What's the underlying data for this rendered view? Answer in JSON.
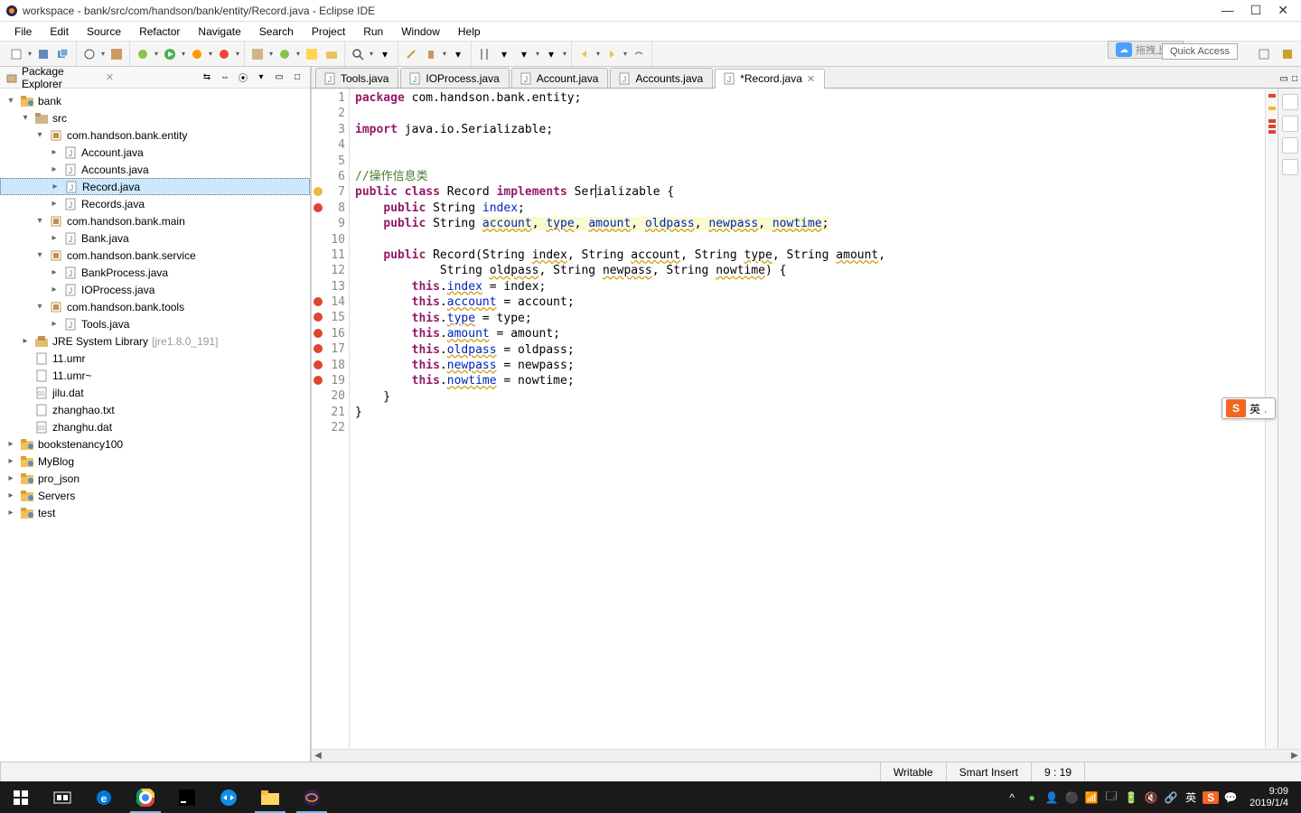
{
  "window": {
    "title": "workspace - bank/src/com/handson/bank/entity/Record.java - Eclipse IDE"
  },
  "menu": [
    "File",
    "Edit",
    "Source",
    "Refactor",
    "Navigate",
    "Search",
    "Project",
    "Run",
    "Window",
    "Help"
  ],
  "quick_access": "Quick Access",
  "tuohuan": "拖拽上传",
  "package_explorer": {
    "title": "Package Explorer",
    "tree": [
      {
        "level": 0,
        "toggle": "▾",
        "icon": "project",
        "label": "bank"
      },
      {
        "level": 1,
        "toggle": "▾",
        "icon": "srcfolder",
        "label": "src"
      },
      {
        "level": 2,
        "toggle": "▾",
        "icon": "package",
        "label": "com.handson.bank.entity"
      },
      {
        "level": 3,
        "toggle": "▸",
        "icon": "jfile",
        "label": "Account.java"
      },
      {
        "level": 3,
        "toggle": "▸",
        "icon": "jfile",
        "label": "Accounts.java"
      },
      {
        "level": 3,
        "toggle": "▸",
        "icon": "jfile",
        "label": "Record.java",
        "selected": true
      },
      {
        "level": 3,
        "toggle": "▸",
        "icon": "jfile",
        "label": "Records.java"
      },
      {
        "level": 2,
        "toggle": "▾",
        "icon": "package",
        "label": "com.handson.bank.main"
      },
      {
        "level": 3,
        "toggle": "▸",
        "icon": "jfile",
        "label": "Bank.java"
      },
      {
        "level": 2,
        "toggle": "▾",
        "icon": "package",
        "label": "com.handson.bank.service"
      },
      {
        "level": 3,
        "toggle": "▸",
        "icon": "jfile",
        "label": "BankProcess.java"
      },
      {
        "level": 3,
        "toggle": "▸",
        "icon": "jfile",
        "label": "IOProcess.java"
      },
      {
        "level": 2,
        "toggle": "▾",
        "icon": "package",
        "label": "com.handson.bank.tools"
      },
      {
        "level": 3,
        "toggle": "▸",
        "icon": "jfile",
        "label": "Tools.java"
      },
      {
        "level": 1,
        "toggle": "▸",
        "icon": "jre",
        "label": "JRE System Library",
        "extra": "[jre1.8.0_191]"
      },
      {
        "level": 1,
        "toggle": "",
        "icon": "file",
        "label": "11.umr"
      },
      {
        "level": 1,
        "toggle": "",
        "icon": "file",
        "label": "11.umr~"
      },
      {
        "level": 1,
        "toggle": "",
        "icon": "dat",
        "label": "jilu.dat"
      },
      {
        "level": 1,
        "toggle": "",
        "icon": "file",
        "label": "zhanghao.txt"
      },
      {
        "level": 1,
        "toggle": "",
        "icon": "dat",
        "label": "zhanghu.dat"
      },
      {
        "level": 0,
        "toggle": "▸",
        "icon": "project",
        "label": "bookstenancy100"
      },
      {
        "level": 0,
        "toggle": "▸",
        "icon": "project",
        "label": "MyBlog"
      },
      {
        "level": 0,
        "toggle": "▸",
        "icon": "project",
        "label": "pro_json"
      },
      {
        "level": 0,
        "toggle": "▸",
        "icon": "project",
        "label": "Servers"
      },
      {
        "level": 0,
        "toggle": "▸",
        "icon": "project",
        "label": "test"
      }
    ]
  },
  "tabs": [
    {
      "label": "Tools.java",
      "active": false
    },
    {
      "label": "IOProcess.java",
      "active": false
    },
    {
      "label": "Account.java",
      "active": false
    },
    {
      "label": "Accounts.java",
      "active": false
    },
    {
      "label": "*Record.java",
      "active": true
    }
  ],
  "code": {
    "lines": [
      {
        "n": 1,
        "html": "<span class='kw'>package</span> com.handson.bank.entity;"
      },
      {
        "n": 2,
        "html": ""
      },
      {
        "n": 3,
        "html": "<span class='kw'>import</span> java.io.Serializable;"
      },
      {
        "n": 4,
        "html": ""
      },
      {
        "n": 5,
        "html": ""
      },
      {
        "n": 6,
        "html": "<span class='cm'>//操作信息类</span>"
      },
      {
        "n": 7,
        "html": "<span class='kw'>public</span> <span class='kw'>class</span> Record <span class='kw'>implements</span> Ser<span class='text-cursor'></span>ializable {",
        "mark": "warn"
      },
      {
        "n": 8,
        "html": "    <span class='kw'>public</span> String <span class='fld'>index</span>;",
        "mark": "err"
      },
      {
        "n": 9,
        "html": "    <span class='kw'>public</span> String <span class='hl'><span class='fld wavy'>account</span>, <span class='fld wavy'>type</span>, <span class='fld wavy'>amount</span>, <span class='fld wavy'>oldpass</span>, <span class='fld wavy'>newpass</span>, <span class='fld wavy'>nowtime</span>;</span>"
      },
      {
        "n": 10,
        "html": ""
      },
      {
        "n": 11,
        "html": "    <span class='kw'>public</span> Record(String <span class='wavy'>index</span>, String <span class='wavy'>account</span>, String <span class='wavy'>type</span>, String <span class='wavy'>amount</span>,"
      },
      {
        "n": 12,
        "html": "            String <span class='wavy'>oldpass</span>, String <span class='wavy'>newpass</span>, String <span class='wavy'>nowtime</span>) {"
      },
      {
        "n": 13,
        "html": "        <span class='kw'>this</span>.<span class='fld wavy'>index</span> = index;"
      },
      {
        "n": 14,
        "html": "        <span class='kw'>this</span>.<span class='fld wavy'>account</span> = account;",
        "mark": "err"
      },
      {
        "n": 15,
        "html": "        <span class='kw'>this</span>.<span class='fld wavy'>type</span> = type;",
        "mark": "err"
      },
      {
        "n": 16,
        "html": "        <span class='kw'>this</span>.<span class='fld wavy'>amount</span> = amount;",
        "mark": "err"
      },
      {
        "n": 17,
        "html": "        <span class='kw'>this</span>.<span class='fld wavy'>oldpass</span> = oldpass;",
        "mark": "err"
      },
      {
        "n": 18,
        "html": "        <span class='kw'>this</span>.<span class='fld wavy'>newpass</span> = newpass;",
        "mark": "err"
      },
      {
        "n": 19,
        "html": "        <span class='kw'>this</span>.<span class='fld wavy'>nowtime</span> = nowtime;",
        "mark": "err"
      },
      {
        "n": 20,
        "html": "    }"
      },
      {
        "n": 21,
        "html": "}"
      },
      {
        "n": 22,
        "html": ""
      }
    ]
  },
  "status": {
    "writable": "Writable",
    "insert": "Smart Insert",
    "pos": "9 : 19"
  },
  "ime_label": "英",
  "taskbar": {
    "time": "9:09",
    "date": "2019/1/4",
    "ime": "英"
  }
}
